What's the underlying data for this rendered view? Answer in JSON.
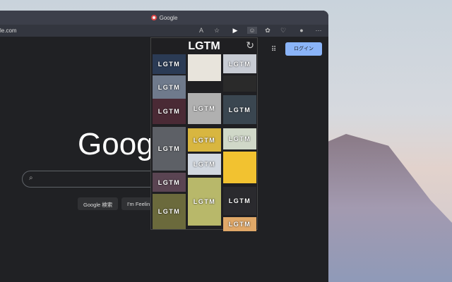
{
  "browser": {
    "tab_title": "Google",
    "url": "le.com"
  },
  "google": {
    "logo": "Google",
    "search_button": "Google 検索",
    "lucky_button": "I'm Feelin",
    "login": "ログイン"
  },
  "popup": {
    "title": "LGTM",
    "reload_icon": "reload-icon",
    "columns": [
      [
        {
          "label": "LGTM",
          "color": "#2b3b55"
        },
        {
          "label": "LGTM",
          "color": "#6f7a8c"
        },
        {
          "label": "LGTM",
          "color": "#4a2a35"
        },
        {
          "label": "LGTM",
          "color": "#5d6066"
        },
        {
          "label": "LGTM",
          "color": "#5a4452"
        },
        {
          "label": "LGTM",
          "color": "#6b6a3c"
        }
      ],
      [
        {
          "label": "",
          "color": "#e8e4dc"
        },
        {
          "label": "LGTM",
          "color": "#b0b0b0"
        },
        {
          "label": "LGTM",
          "color": "#d8b640"
        },
        {
          "label": "LGTM",
          "color": "#d2d8e0"
        },
        {
          "label": "LGTM",
          "color": "#b8b86a"
        }
      ],
      [
        {
          "label": "LGTM",
          "color": "#c8ccd4"
        },
        {
          "label": "",
          "color": "#2a2a2a"
        },
        {
          "label": "LGTM",
          "color": "#3a4650"
        },
        {
          "label": "LGTM",
          "color": "#d0d8c8"
        },
        {
          "label": "",
          "color": "#f2c230"
        },
        {
          "label": "LGTM",
          "color": "#2a2a2e"
        },
        {
          "label": "LGTM",
          "color": "#e0a868"
        }
      ]
    ]
  }
}
